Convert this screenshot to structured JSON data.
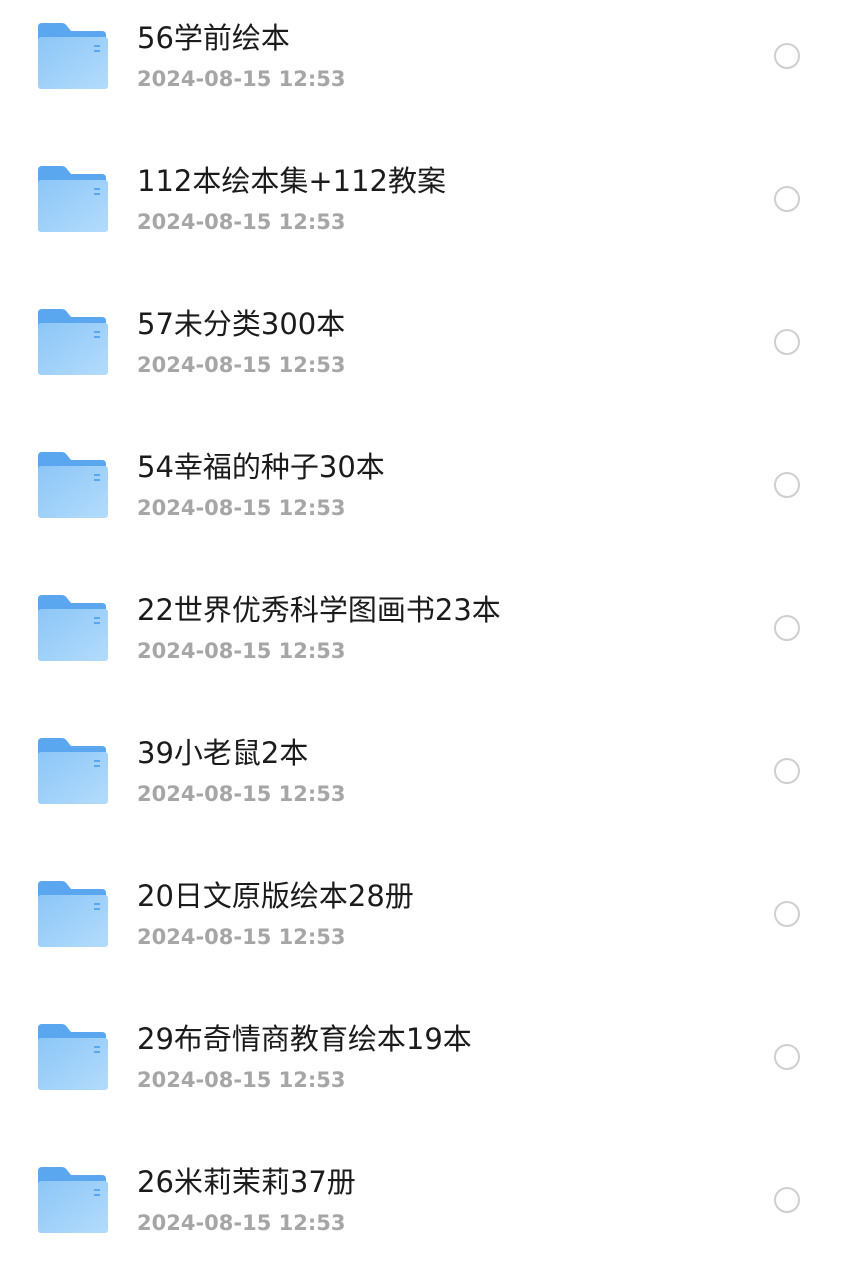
{
  "files": [
    {
      "name": "56学前绘本",
      "date": "2024-08-15 12:53",
      "icon": "folder-icon"
    },
    {
      "name": "112本绘本集+112教案",
      "date": "2024-08-15 12:53",
      "icon": "folder-icon"
    },
    {
      "name": "57未分类300本",
      "date": "2024-08-15 12:53",
      "icon": "folder-icon"
    },
    {
      "name": "54幸福的种子30本",
      "date": "2024-08-15 12:53",
      "icon": "folder-icon"
    },
    {
      "name": "22世界优秀科学图画书23本",
      "date": "2024-08-15 12:53",
      "icon": "folder-icon"
    },
    {
      "name": "39小老鼠2本",
      "date": "2024-08-15 12:53",
      "icon": "folder-icon"
    },
    {
      "name": "20日文原版绘本28册",
      "date": "2024-08-15 12:53",
      "icon": "folder-icon"
    },
    {
      "name": "29布奇情商教育绘本19本",
      "date": "2024-08-15 12:53",
      "icon": "folder-icon"
    },
    {
      "name": "26米莉茉莉37册",
      "date": "2024-08-15 12:53",
      "icon": "folder-icon"
    }
  ],
  "colors": {
    "folder_back": "#5aa7ef",
    "folder_front_top": "#8cc6f7",
    "folder_front_bottom": "#b3dcfb",
    "name_text": "#1b1b1b",
    "date_text": "#a6a6a6",
    "radio_border": "#cfcfcf"
  }
}
